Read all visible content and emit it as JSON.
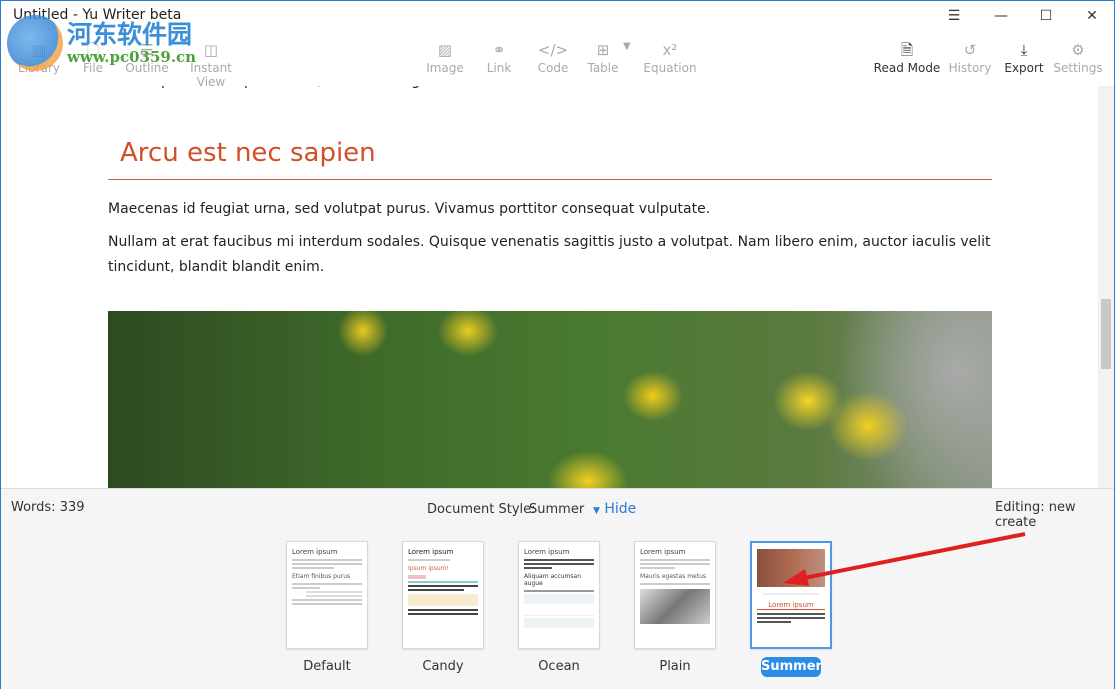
{
  "window": {
    "title": "Untitled - Yu Writer beta"
  },
  "watermark": {
    "text": "河东软件园",
    "url": "www.pc0359.cn"
  },
  "toolbar": {
    "left": [
      {
        "label": "Library",
        "icon": "library-icon"
      },
      {
        "label": "File",
        "icon": "file-icon"
      },
      {
        "label": "Outline",
        "icon": "outline-icon"
      },
      {
        "label": "Instant View",
        "icon": "columns-icon"
      }
    ],
    "insert": [
      {
        "label": "Image",
        "icon": "image-icon"
      },
      {
        "label": "Link",
        "icon": "link-icon"
      },
      {
        "label": "Code",
        "icon": "code-icon"
      },
      {
        "label": "Table",
        "icon": "table-icon"
      },
      {
        "label": "Equation",
        "icon": "equation-icon"
      }
    ],
    "right": [
      {
        "label": "Read Mode",
        "icon": "document-icon"
      },
      {
        "label": "History",
        "icon": "history-icon"
      },
      {
        "label": "Export",
        "icon": "download-icon"
      },
      {
        "label": "Settings",
        "icon": "gear-icon"
      }
    ]
  },
  "editor": {
    "cut_line": "nisi. Ut pulvinar aliquam nulla, id cursus augue tincidunt sed.",
    "heading": "Arcu est nec sapien",
    "p1": "Maecenas id feugiat urna, sed volutpat purus. Vivamus porttitor consequat vulputate.",
    "p2": "Nullam at erat faucibus mi interdum sodales. Quisque venenatis sagittis justo a volutpat. Nam libero enim, auctor iaculis velit tincidunt, blandit blandit enim.",
    "heading_color": "#d0502a"
  },
  "status": {
    "words": "Words: 339",
    "style_label": "Document Style:",
    "style_value": "Summer",
    "hide": "Hide",
    "editing": "Editing: new create"
  },
  "styles": [
    {
      "name": "Default",
      "heading": "Lorem ipsum",
      "sub": "Etiam finibus purus"
    },
    {
      "name": "Candy",
      "heading": "Lorem ipsum",
      "sub": "Ipsum ipsum!"
    },
    {
      "name": "Ocean",
      "heading": "Lorem ipsum",
      "sub": "Aliquam accumsan augue"
    },
    {
      "name": "Plain",
      "heading": "Lorem ipsum",
      "sub": "Mauris egestas metus"
    },
    {
      "name": "Summer",
      "heading": "Lorem ipsum",
      "selected": true
    }
  ],
  "accent": "#2b8ce6"
}
